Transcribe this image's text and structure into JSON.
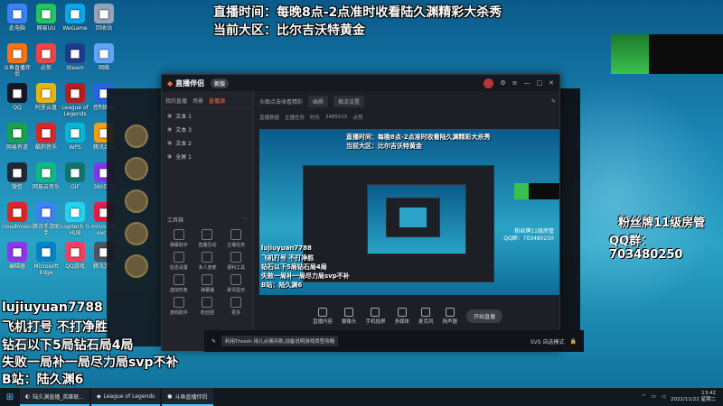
{
  "overlay": {
    "top_line1": "直播时间：每晚8点-2点准时收看陆久渊精彩大杀秀",
    "top_line2": "当前大区：比尔吉沃特黄金",
    "bottom_lines": [
      "lujiuyuan7788",
      "飞机打号 不打净胜",
      "钻石以下5局钻石局4局",
      "失败一局补一局尽力局svp不补",
      "B站：陆久渊6"
    ],
    "fan_label": "粉丝牌11级房管",
    "qq_label": "QQ群：703480250"
  },
  "window": {
    "app_name": "直播伴侣",
    "badge": "新版",
    "left_tabs": [
      "我的直播",
      "场景",
      "直播源"
    ],
    "scenes": [
      "文本 1",
      "文本 3",
      "文本 2",
      "全屏 1"
    ],
    "tools_label": "工具箱",
    "tools": [
      "弹幕助手",
      "直播互动",
      "主播任务",
      "信息设置",
      "多人连麦",
      "便利工具",
      "虚拟形象",
      "弹幕播",
      "歌词显示",
      "游戏助手",
      "粉丝团",
      "更多"
    ],
    "toolbar": [
      "头图点击收看精彩",
      "画质",
      "推流设置"
    ],
    "subbar": [
      "直播数据",
      "主播任务",
      "时长",
      "3485515",
      "点赞"
    ],
    "bottom_buttons": [
      "直播内容",
      "摄像头",
      "手机投屏",
      "多媒体",
      "麦克风",
      "扬声器"
    ],
    "start_label": "开始直播",
    "preview_line1": "直播时间：每晚8点-2点准时收看陆久渊精彩大杀秀",
    "preview_line2": "当前大区：比尔吉沃特黄金",
    "preview_fan": "粉丝牌11级房管",
    "preview_qq": "QQ群：703480250",
    "preview_bottom": [
      "lujiuyuan7788",
      "飞机打号 不打净胜",
      "钻石以下5局钻石局4局",
      "失败一局补一局尽力局svp不补",
      "B站：陆久渊6"
    ]
  },
  "chat": {
    "bubble": "利用Thresh 用儿点佣兵刷,战备说明游戏类型攻略",
    "sub": "SVS 自选模式"
  },
  "desktop_icons": [
    "此电脑",
    "网易UU",
    "WeGame",
    "回收站",
    "斗鱼直播伴侣",
    "必剪",
    "Steam",
    "网络",
    "QQ",
    "阿里云盘",
    "League of Legends",
    "控制面板",
    "网易有道",
    "酷狗音乐",
    "WPS",
    "腾讯会议",
    "微信",
    "网易云音乐",
    "GIF",
    "360压缩",
    "cloudmusic",
    "腾讯手游助手",
    "Logitech G HUB",
    "microsoft excel",
    "编辑器",
    "Microsoft Edge",
    "QQ游戏",
    "腾讯游戏"
  ],
  "taskbar": {
    "items": [
      "陆久渊直播_英雄联...",
      "League of Legends",
      "斗鱼直播伴侣"
    ],
    "time": "13:42",
    "date": "2022/11/22 星期二"
  },
  "colors": {
    "accent": "#ff6a3d",
    "green": "#3ac24e",
    "window_bg": "#1d1f26"
  }
}
